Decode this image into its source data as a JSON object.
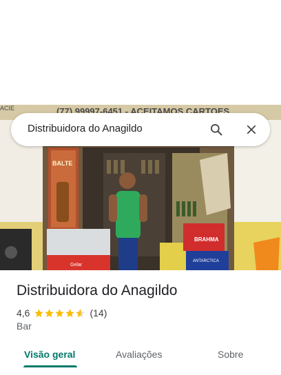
{
  "photo": {
    "store_sign": "(77) 99997-6451 - ACEITAMOS CARTOES",
    "left_sign_fragment": "ACIE",
    "poster_text": "BALTE",
    "crate_brand_1": "BRAHMA",
    "crate_brand_2": "ANTARCTICA",
    "fridge_brand": "Gelar"
  },
  "search": {
    "query": "Distribuidora do Anagildo",
    "search_icon": "search-icon",
    "close_icon": "close-icon"
  },
  "place": {
    "name": "Distribuidora do Anagildo",
    "rating": "4,6",
    "rating_value": 4.6,
    "review_count": "(14)",
    "category": "Bar",
    "star_color": "#fbbc04"
  },
  "tabs": [
    {
      "label": "Visão geral",
      "active": true
    },
    {
      "label": "Avaliações",
      "active": false
    },
    {
      "label": "Sobre",
      "active": false
    }
  ],
  "colors": {
    "accent": "#00796b",
    "text_primary": "#202124",
    "text_secondary": "#5f6368"
  }
}
